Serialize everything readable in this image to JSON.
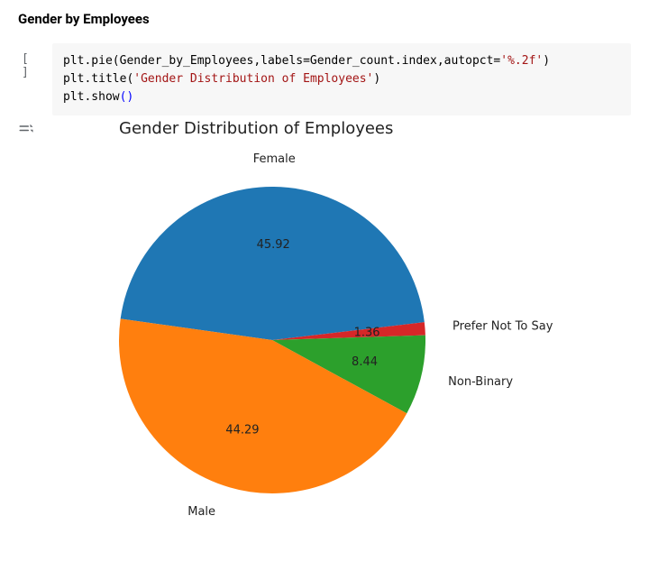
{
  "section_heading": "Gender by Employees",
  "cell": {
    "prompt": "[ ]",
    "code_html": "plt.pie(Gender_by_Employees,labels=Gender_count.index,autopct=<span class=\"tok-str\">'%.2f'</span>)\nplt.title(<span class=\"tok-str\">'Gender Distribution of Employees'</span>)\nplt.show<span class=\"tok-paren\">()</span>"
  },
  "chart_data": {
    "type": "pie",
    "title": "Gender Distribution of Employees",
    "series": [
      {
        "name": "Female",
        "value": 45.92,
        "color": "#1f77b4"
      },
      {
        "name": "Prefer Not To Say",
        "value": 1.36,
        "color": "#d62728"
      },
      {
        "name": "Non-Binary",
        "value": 8.44,
        "color": "#2ca02c"
      },
      {
        "name": "Male",
        "value": 44.29,
        "color": "#ff7f0e"
      }
    ],
    "start_angle_deg": 172,
    "direction": "clockwise"
  }
}
